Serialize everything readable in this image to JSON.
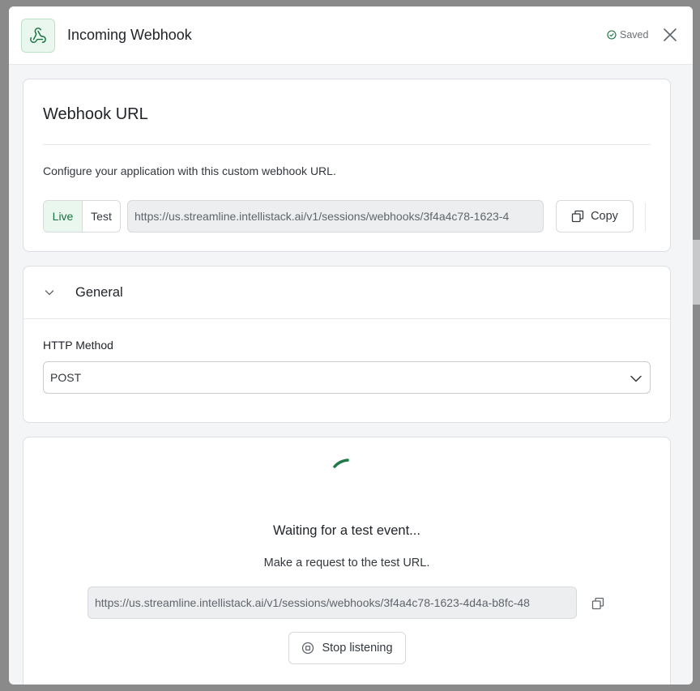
{
  "header": {
    "title": "Incoming Webhook",
    "saved_label": "Saved",
    "logo_icon": "webhook-icon",
    "close_icon": "close-icon"
  },
  "webhook_url": {
    "title": "Webhook URL",
    "description": "Configure your application with this custom webhook URL.",
    "modes": [
      "Live",
      "Test"
    ],
    "selected_mode": "Live",
    "url": "https://us.streamline.intellistack.ai/v1/sessions/webhooks/3f4a4c78-1623-4",
    "copy_label": "Copy"
  },
  "general": {
    "title": "General",
    "http_method_label": "HTTP Method",
    "http_method_value": "POST"
  },
  "test_listener": {
    "waiting_text": "Waiting for a test event...",
    "instruction": "Make a request to the test URL.",
    "test_url": "https://us.streamline.intellistack.ai/v1/sessions/webhooks/3f4a4c78-1623-4d4a-b8fc-48",
    "stop_label": "Stop listening"
  },
  "colors": {
    "accent": "#16703f",
    "accent_bg": "#eaf7ef",
    "spinner": "#1e7a4a"
  }
}
